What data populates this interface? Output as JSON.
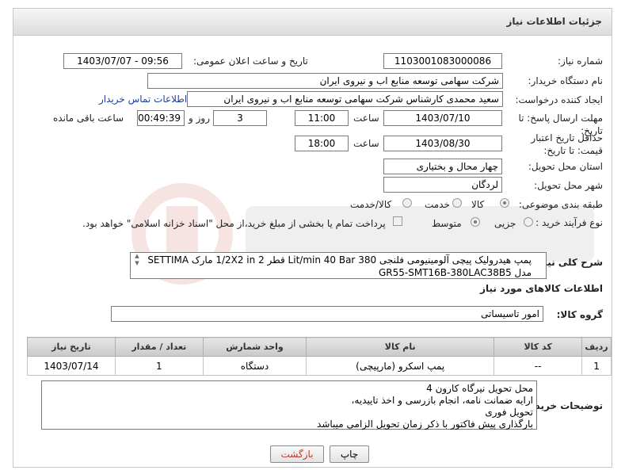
{
  "header": {
    "title": "جزئیات اطلاعات نیاز"
  },
  "form": {
    "need_number_label": "شماره نیاز:",
    "need_number": "1103001083000086",
    "announce_label": "تاریخ و ساعت اعلان عمومی:",
    "announce_value": "1403/07/07 - 09:56",
    "buyer_label": "نام دستگاه خریدار:",
    "buyer_value": "شرکت سهامی توسعه منابع اب و نیروی ایران",
    "creator_label": "ایجاد کننده درخواست:",
    "creator_value": "سعید محمدی کارشناس شرکت سهامی توسعه منابع اب و نیروی ایران",
    "contact_link": "اطلاعات تماس خریدار",
    "deadline_label": "مهلت ارسال پاسخ: تا تاریخ:",
    "deadline_date": "1403/07/10",
    "time_label": "ساعت",
    "deadline_time": "11:00",
    "days_value": "3",
    "days_label": "روز و",
    "remaining_value": "00:49:39",
    "remaining_label": "ساعت باقی مانده",
    "price_label": "حداقل تاریخ اعتبار قیمت: تا تاریخ:",
    "price_date": "1403/08/30",
    "price_time_label": "ساعت",
    "price_time": "18:00",
    "province_label": "استان محل تحویل:",
    "province_value": "چهار محال و بختیاری",
    "city_label": "شهر محل تحویل:",
    "city_value": "لردگان",
    "category_label": "طبقه بندی موضوعی:",
    "category_options": [
      "کالا",
      "خدمت",
      "کالا/خدمت"
    ],
    "process_label": "نوع فرآیند خرید :",
    "process_options": [
      "جزیی",
      "متوسط"
    ],
    "treasury_text": "پرداخت تمام یا بخشی از مبلغ خرید،از محل \"اسناد خزانه اسلامی\" خواهد بود."
  },
  "description": {
    "label": "شرح کلی نیاز:",
    "text": "پمپ هیدرولیک پیچی آلومینیومی فلنجی 380 Lit/min 40 Bar قطر 2 1/2X2 in مارک SETTIMA مدل GR55-SMT16B-380LAC38B5"
  },
  "goods": {
    "section_title": "اطلاعات کالاهای مورد نیاز",
    "group_label": "گروه کالا:",
    "group_value": "امور تاسیساتی",
    "columns": [
      "ردیف",
      "کد کالا",
      "نام کالا",
      "واحد شمارش",
      "تعداد / مقدار",
      "تاریخ نیاز"
    ],
    "rows": [
      {
        "row": "1",
        "code": "--",
        "name": "پمپ اسکرو (مارپیچی)",
        "unit": "دستگاه",
        "qty": "1",
        "date": "1403/07/14"
      }
    ]
  },
  "notes": {
    "label": "توضیحات خریدار:",
    "lines": [
      "محل تحویل نیرگاه کارون 4",
      "ارایه ضمانت نامه، انجام بازرسی و اخذ تاییدیه،",
      "تحویل فوری",
      "بارگذاری پیش فاکتور با ذکر زمان تحویل الزامی میباشد"
    ]
  },
  "buttons": {
    "print": "چاپ",
    "back": "بازگشت"
  },
  "colors": {
    "link": "#1a3fa6",
    "back_text": "#c0392b"
  }
}
